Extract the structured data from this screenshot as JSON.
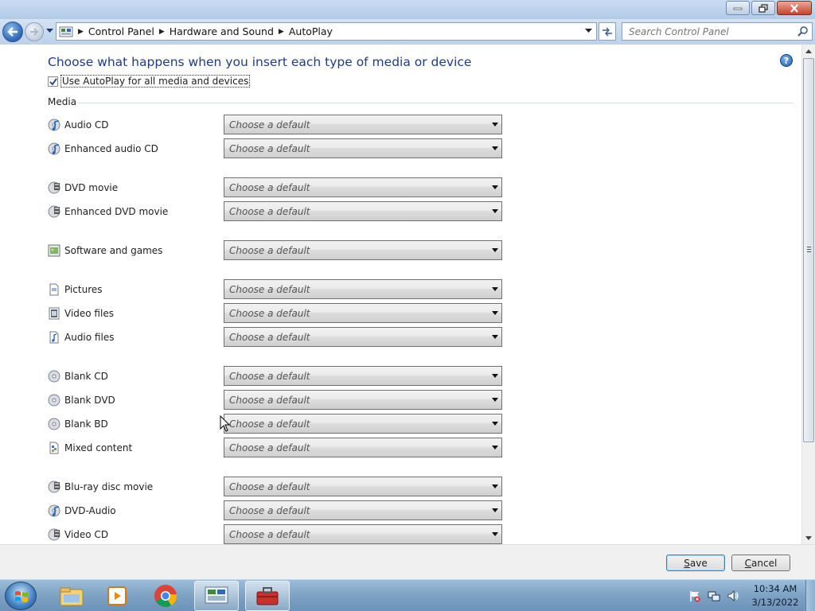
{
  "window": {
    "controls": [
      "minimize-icon",
      "restore-icon",
      "close-icon"
    ]
  },
  "nav": {
    "breadcrumbs": [
      "Control Panel",
      "Hardware and Sound",
      "AutoPlay"
    ],
    "search_placeholder": "Search Control Panel"
  },
  "page": {
    "heading": "Choose what happens when you insert each type of media or device",
    "help_label": "?",
    "autoplay_checkbox_label": "Use AutoPlay for all media and devices",
    "autoplay_checked": true,
    "group_label": "Media",
    "dropdown_placeholder": "Choose a default"
  },
  "media_items": [
    {
      "label": "Audio CD",
      "icon": "audio-cd-icon",
      "value": "Choose a default"
    },
    {
      "label": "Enhanced audio CD",
      "icon": "enhanced-audio-cd-icon",
      "value": "Choose a default"
    },
    {
      "label": "DVD movie",
      "icon": "dvd-movie-icon",
      "value": "Choose a default"
    },
    {
      "label": "Enhanced DVD movie",
      "icon": "enhanced-dvd-movie-icon",
      "value": "Choose a default"
    },
    {
      "label": "Software and games",
      "icon": "software-games-icon",
      "value": "Choose a default"
    },
    {
      "label": "Pictures",
      "icon": "pictures-icon",
      "value": "Choose a default"
    },
    {
      "label": "Video files",
      "icon": "video-files-icon",
      "value": "Choose a default"
    },
    {
      "label": "Audio files",
      "icon": "audio-files-icon",
      "value": "Choose a default"
    },
    {
      "label": "Blank CD",
      "icon": "blank-cd-icon",
      "value": "Choose a default"
    },
    {
      "label": "Blank DVD",
      "icon": "blank-dvd-icon",
      "value": "Choose a default"
    },
    {
      "label": "Blank BD",
      "icon": "blank-bd-icon",
      "value": "Choose a default"
    },
    {
      "label": "Mixed content",
      "icon": "mixed-content-icon",
      "value": "Choose a default"
    },
    {
      "label": "Blu-ray disc movie",
      "icon": "bluray-movie-icon",
      "value": "Choose a default"
    },
    {
      "label": "DVD-Audio",
      "icon": "dvd-audio-icon",
      "value": "Choose a default"
    },
    {
      "label": "Video CD",
      "icon": "video-cd-icon",
      "value": "Choose a default"
    }
  ],
  "buttons": {
    "save_prefix": "",
    "save_accel": "S",
    "save_rest": "ave",
    "cancel_accel": "C",
    "cancel_rest": "ancel"
  },
  "taskbar": {
    "items": [
      "file-explorer-icon",
      "media-player-icon",
      "chrome-icon",
      "control-panel-icon",
      "toolbox-icon"
    ],
    "active_item": "control-panel-icon",
    "tray_icons": [
      "action-center-flag-icon",
      "network-icon",
      "volume-icon"
    ],
    "time": "10:34 AM",
    "date": "3/13/2022"
  },
  "colors": {
    "heading": "#1e3b87",
    "window_chrome": "#bcd3ec",
    "taskbar": "#7ea2c4"
  }
}
